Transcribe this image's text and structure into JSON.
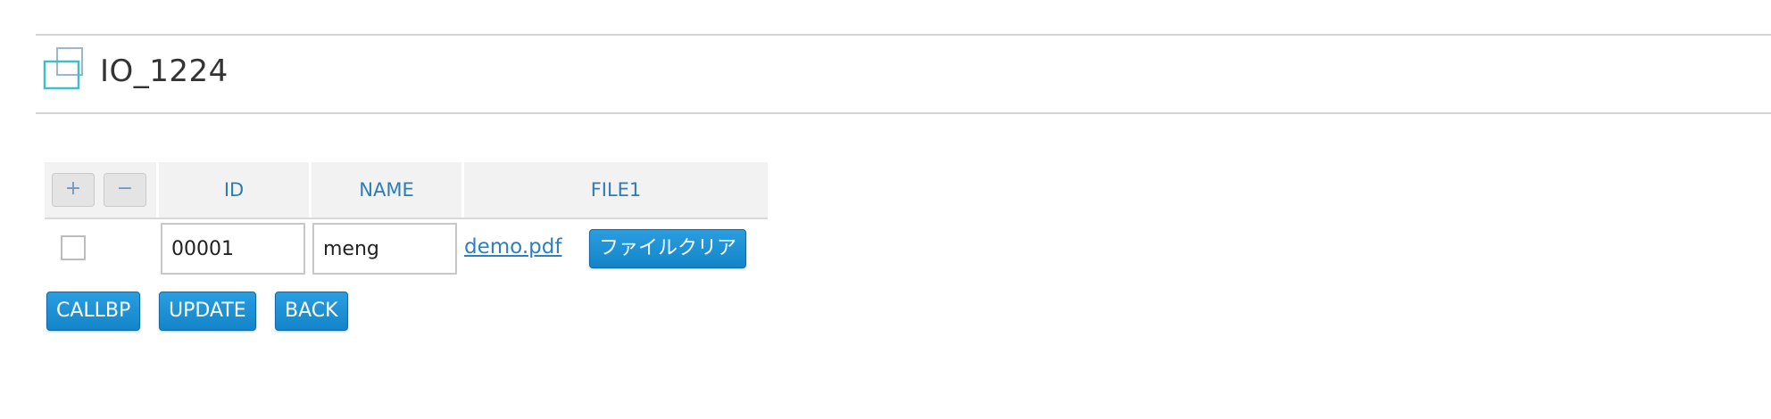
{
  "page": {
    "title": "IO_1224"
  },
  "grid": {
    "add_row_label": "+",
    "remove_row_label": "−",
    "columns": {
      "id": "ID",
      "name": "NAME",
      "file1": "FILE1"
    },
    "rows": [
      {
        "checked": false,
        "id": "00001",
        "name": "meng",
        "file_name": "demo.pdf",
        "clear_file_label": "ファイルクリア"
      }
    ]
  },
  "actions": {
    "callbp_label": "CALLBP",
    "update_label": "UPDATE",
    "back_label": "BACK"
  },
  "colors": {
    "accent": "#1a8fd6",
    "header_text": "#2c7cb5",
    "link": "#2f7fbf",
    "icon_teal": "#3fbfc9"
  },
  "icons": {
    "title_icon": "layered-squares-icon",
    "add_row": "plus-icon",
    "remove_row": "minus-icon"
  }
}
